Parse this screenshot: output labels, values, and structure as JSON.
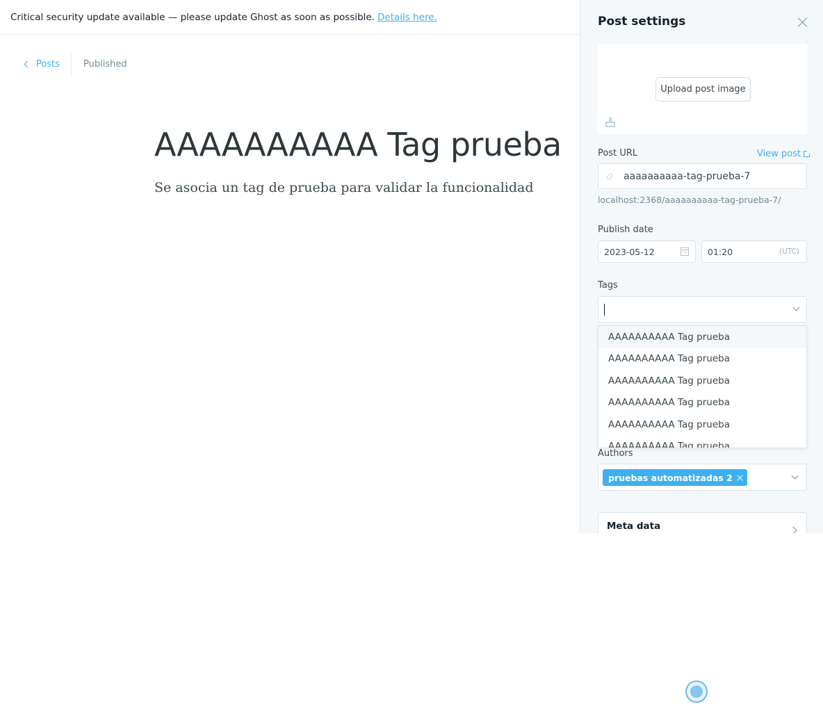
{
  "banner": {
    "message": "Critical security update available — please update Ghost as soon as possible.",
    "link_text": "Details here."
  },
  "nav": {
    "back_label": "Posts",
    "status": "Published"
  },
  "editor": {
    "title": "AAAAAAAAAA Tag prueba",
    "body": "Se asocia un tag de prueba para validar la funcionalidad"
  },
  "settings": {
    "title": "Post settings",
    "upload_label": "Upload post image",
    "post_url_label": "Post URL",
    "view_post_label": "View post",
    "post_url_value": "aaaaaaaaaa-tag-prueba-7",
    "post_url_full": "localhost:2368/aaaaaaaaaa-tag-prueba-7/",
    "publish_date_label": "Publish date",
    "publish_date": "2023-05-12",
    "publish_time": "01:20",
    "timezone": "(UTC)",
    "tags_label": "Tags",
    "tag_options": [
      "AAAAAAAAAA Tag prueba",
      "AAAAAAAAAA Tag prueba",
      "AAAAAAAAAA Tag prueba",
      "AAAAAAAAAA Tag prueba",
      "AAAAAAAAAA Tag prueba",
      "AAAAAAAAAA Tag prueba"
    ],
    "authors_label": "Authors",
    "author_token": "pruebas automatizadas 2",
    "meta_data_label": "Meta data"
  },
  "colors": {
    "accent": "#3eb0ef",
    "panel_bg": "#f4f8fb"
  },
  "icons": [
    "chevron-left-icon",
    "close-icon",
    "image-icon",
    "external-link-icon",
    "link-icon",
    "calendar-icon",
    "chevron-down-icon",
    "chevron-right-icon"
  ]
}
